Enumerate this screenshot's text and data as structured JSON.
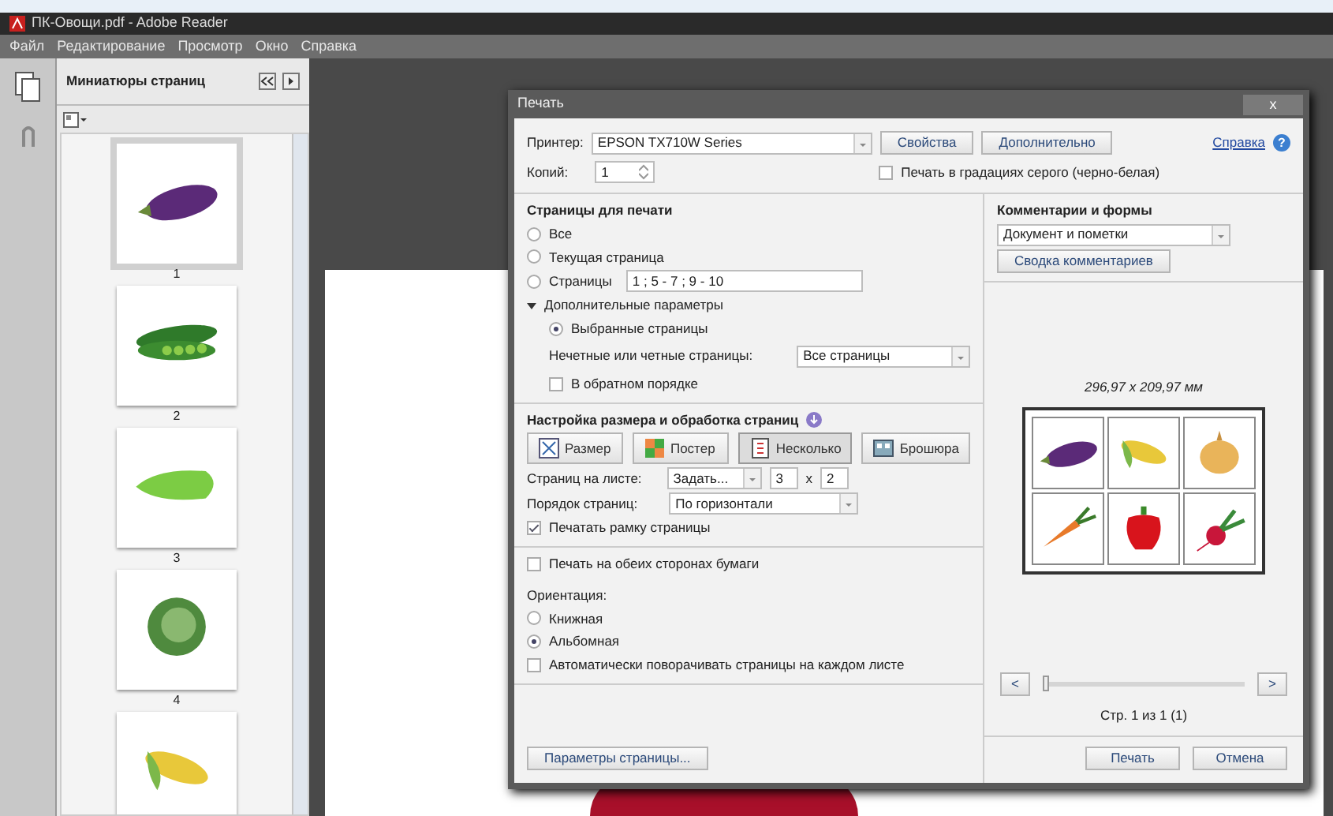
{
  "window": {
    "title": "ПК-Овощи.pdf - Adobe Reader"
  },
  "menu": [
    "Файл",
    "Редактирование",
    "Просмотр",
    "Окно",
    "Справка"
  ],
  "thumbnails_panel": {
    "title": "Миниатюры страниц",
    "pages": [
      {
        "label": "1",
        "kind": "eggplant",
        "selected": true
      },
      {
        "label": "2",
        "kind": "peas",
        "selected": false
      },
      {
        "label": "3",
        "kind": "squash",
        "selected": false
      },
      {
        "label": "4",
        "kind": "cabbage",
        "selected": false
      },
      {
        "kind": "corn",
        "selected": false
      }
    ]
  },
  "print_dialog": {
    "title": "Печать",
    "close": "x",
    "printer_label": "Принтер:",
    "printer": "EPSON TX710W Series",
    "properties_button": "Свойства",
    "advanced_button": "Дополнительно",
    "help_link": "Справка",
    "help_glyph": "?",
    "copies_label": "Копий:",
    "copies": "1",
    "grayscale": {
      "label": "Печать в градациях серого (черно-белая)",
      "checked": false
    },
    "pages_section": {
      "title": "Страницы для печати",
      "options": [
        {
          "label": "Все",
          "selected": false
        },
        {
          "label": "Текущая страница",
          "selected": false
        },
        {
          "label": "Страницы",
          "selected": false,
          "value": "1 ; 5 - 7 ; 9 - 10"
        }
      ],
      "more": {
        "label": "Дополнительные параметры",
        "expanded": true
      },
      "selected_pages": {
        "label": "Выбранные страницы",
        "selected": true
      },
      "odd_even_label": "Нечетные или четные страницы:",
      "odd_even": "Все страницы",
      "reverse": {
        "label": "В обратном порядке",
        "checked": false
      }
    },
    "sizing_section": {
      "title": "Настройка размера и обработка страниц",
      "modes": [
        {
          "label": "Размер",
          "kind": "size",
          "selected": false
        },
        {
          "label": "Постер",
          "kind": "poster",
          "selected": false
        },
        {
          "label": "Несколько",
          "kind": "multiple",
          "selected": true
        },
        {
          "label": "Брошюра",
          "kind": "booklet",
          "selected": false
        }
      ],
      "per_sheet_label": "Страниц на листе:",
      "per_sheet": "Задать...",
      "columns": "3",
      "times": "x",
      "rows": "2",
      "order_label": "Порядок страниц:",
      "order": "По горизонтали",
      "border": {
        "label": "Печатать рамку страницы",
        "checked": true
      }
    },
    "duplex": {
      "label": "Печать на обеих сторонах бумаги",
      "checked": false
    },
    "orientation": {
      "title": "Ориентация:",
      "options": [
        {
          "label": "Книжная",
          "selected": false
        },
        {
          "label": "Альбомная",
          "selected": true
        }
      ],
      "auto_rotate": {
        "label": "Автоматически поворачивать страницы на каждом листе",
        "checked": false
      }
    },
    "page_setup_button": "Параметры страницы...",
    "comments": {
      "title": "Комментарии и формы",
      "value": "Документ и пометки",
      "summary_button": "Сводка комментариев"
    },
    "preview": {
      "size": "296,97 x 209,97 мм",
      "cells": [
        {
          "kind": "eggplant"
        },
        {
          "kind": "corn"
        },
        {
          "kind": "onion"
        },
        {
          "kind": "carrot"
        },
        {
          "kind": "pepper"
        },
        {
          "kind": "radish"
        }
      ],
      "prev": "<",
      "next": ">",
      "level": 0,
      "page_info": "Стр. 1 из 1 (1)"
    },
    "print_button": "Печать",
    "cancel_button": "Отмена"
  }
}
